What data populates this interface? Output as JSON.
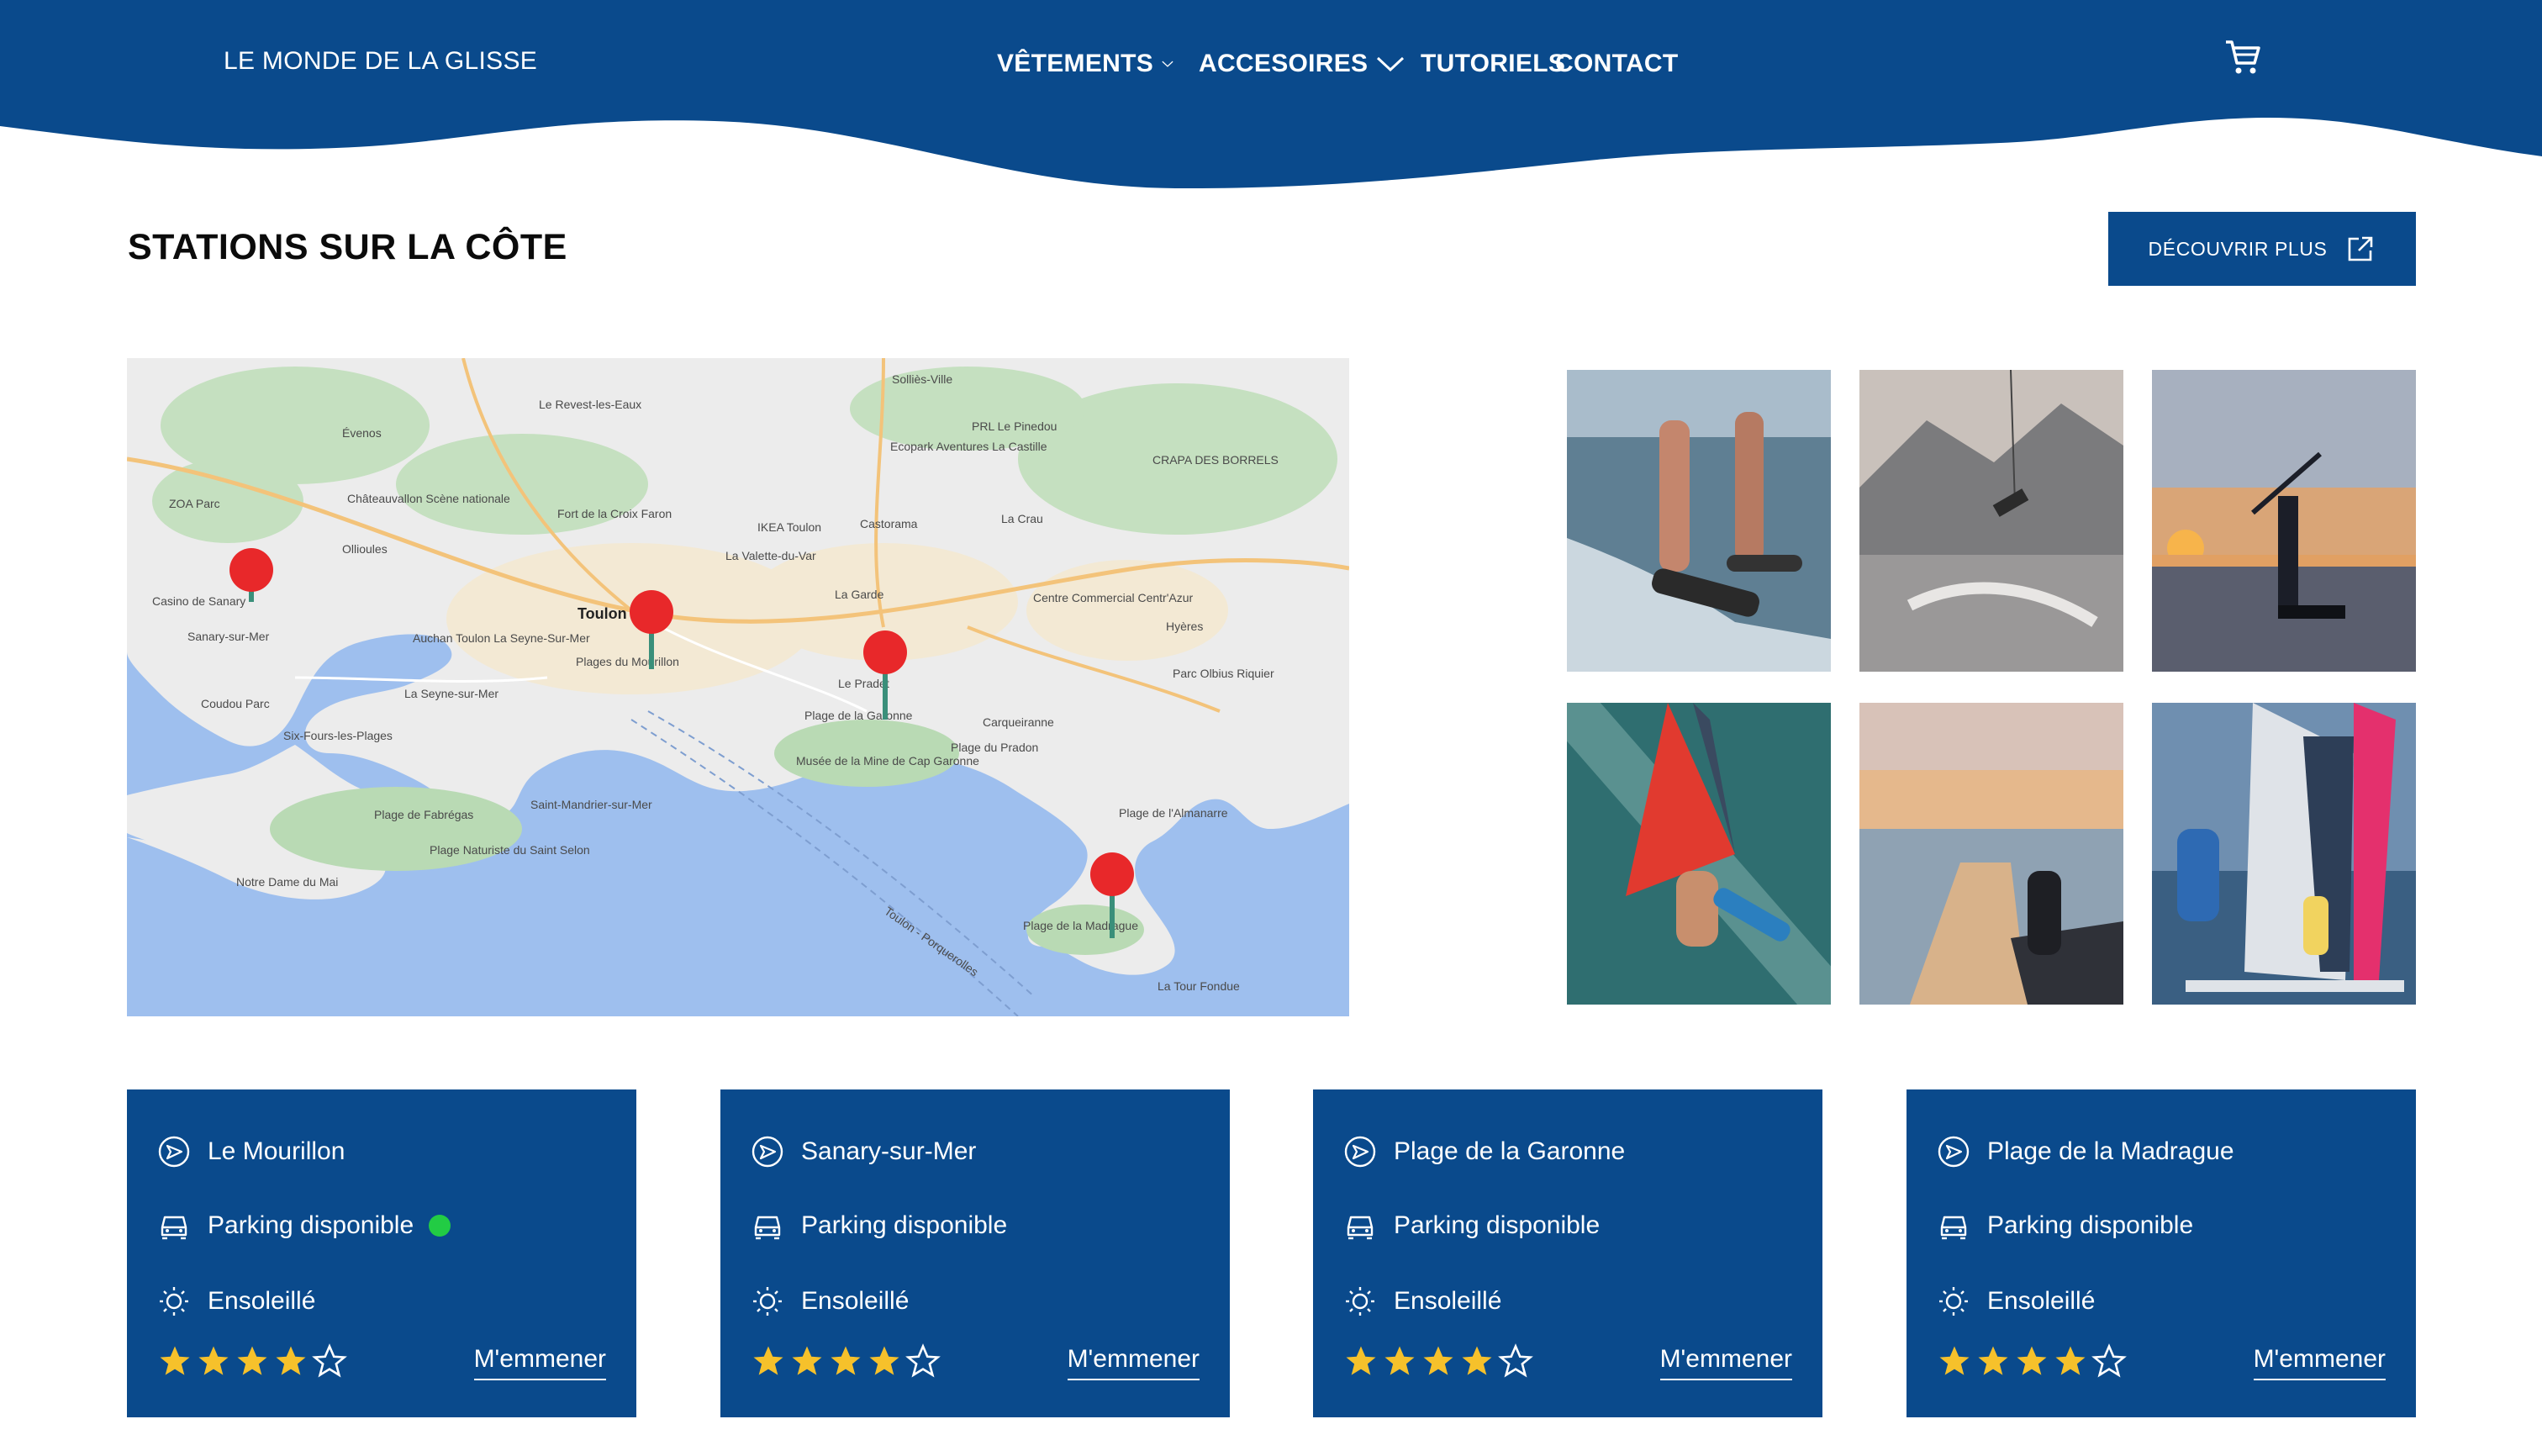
{
  "header": {
    "brand": "LE MONDE DE LA GLISSE",
    "nav": [
      {
        "label": "VÊTEMENTS"
      },
      {
        "label": "ACCESOIRES"
      },
      {
        "label": "TUTORIELS"
      },
      {
        "label": "CONTACT"
      }
    ],
    "cart_icon": "shopping-cart-icon",
    "colors": {
      "primary": "#0a4a8c"
    }
  },
  "section": {
    "title": "STATIONS SUR LA CÔTE",
    "discover_label": "DÉCOUVRIR PLUS"
  },
  "map": {
    "labels": [
      {
        "text": "Solliès-Ville"
      },
      {
        "text": "Le Revest-les-Eaux"
      },
      {
        "text": "PRL Le Pinedou"
      },
      {
        "text": "Évenos"
      },
      {
        "text": "Ecopark Aventures La Castille"
      },
      {
        "text": "CRAPA DES BORRELS"
      },
      {
        "text": "ZOA Parc"
      },
      {
        "text": "Châteauvallon Scène nationale"
      },
      {
        "text": "Fort de la Croix Faron"
      },
      {
        "text": "IKEA Toulon"
      },
      {
        "text": "Castorama"
      },
      {
        "text": "La Crau"
      },
      {
        "text": "Ollioules"
      },
      {
        "text": "La Valette-du-Var"
      },
      {
        "text": "Casino de Sanary"
      },
      {
        "text": "Toulon"
      },
      {
        "text": "La Garde"
      },
      {
        "text": "Centre Commercial Centr'Azur"
      },
      {
        "text": "Sanary-sur-Mer"
      },
      {
        "text": "Auchan Toulon La Seyne-Sur-Mer"
      },
      {
        "text": "Hyères"
      },
      {
        "text": "Plages du Mourillon"
      },
      {
        "text": "Le Pradet"
      },
      {
        "text": "Parc Olbius Riquier"
      },
      {
        "text": "Coudou Parc"
      },
      {
        "text": "La Seyne-sur-Mer"
      },
      {
        "text": "Carqueiranne"
      },
      {
        "text": "Six-Fours-les-Plages"
      },
      {
        "text": "Plage de la Garonne"
      },
      {
        "text": "Plage du Pradon"
      },
      {
        "text": "Musée de la Mine de Cap Garonne"
      },
      {
        "text": "Saint-Mandrier-sur-Mer"
      },
      {
        "text": "Plage de Fabrégas"
      },
      {
        "text": "Plage Naturiste du Saint Selon"
      },
      {
        "text": "Plage de l'Almanarre"
      },
      {
        "text": "Notre Dame du Mai"
      },
      {
        "text": "Plage de la Madrague"
      },
      {
        "text": "La Tour Fondue"
      },
      {
        "text": "Toulon - Porquerolles"
      }
    ]
  },
  "gallery": {
    "photos": [
      {
        "name": "wakeboard-photo"
      },
      {
        "name": "wakeboard-jump-photo"
      },
      {
        "name": "paddle-sunset-photo"
      },
      {
        "name": "windsurf-photo"
      },
      {
        "name": "paddle-board-photo"
      },
      {
        "name": "windsurf-kids-photo"
      }
    ]
  },
  "cards": [
    {
      "place": "Le Mourillon",
      "parking": "Parking disponible",
      "weather": "Ensoleillé",
      "rating": 4,
      "max_rating": 5,
      "action": "M'emmener",
      "available_dot": true
    },
    {
      "place": "Sanary-sur-Mer",
      "parking": "Parking disponible",
      "weather": "Ensoleillé",
      "rating": 4,
      "max_rating": 5,
      "action": "M'emmener",
      "available_dot": false
    },
    {
      "place": "Plage de la Garonne",
      "parking": "Parking disponible",
      "weather": "Ensoleillé",
      "rating": 4,
      "max_rating": 5,
      "action": "M'emmener",
      "available_dot": false
    },
    {
      "place": "Plage de la Madrague",
      "parking": "Parking disponible",
      "weather": "Ensoleillé",
      "rating": 4,
      "max_rating": 5,
      "action": "M'emmener",
      "available_dot": false
    }
  ],
  "colors": {
    "card_bg": "#0a4a8c",
    "star": "#f6c12b",
    "available": "#22cc44"
  }
}
